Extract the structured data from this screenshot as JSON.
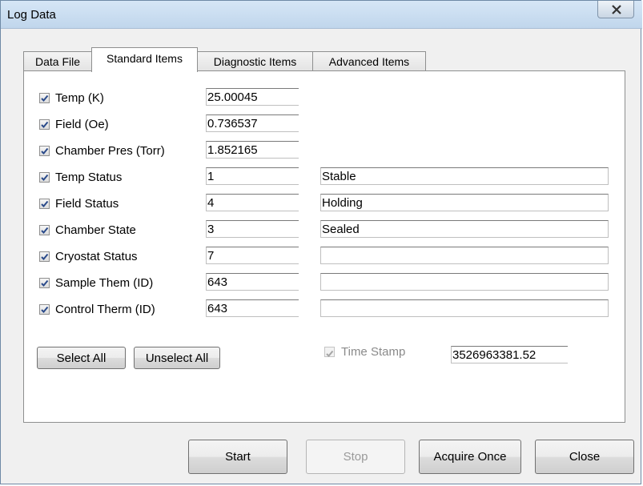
{
  "window": {
    "title": "Log Data"
  },
  "tabs": [
    {
      "label": "Data File",
      "active": false
    },
    {
      "label": "Standard Items",
      "active": true
    },
    {
      "label": "Diagnostic Items",
      "active": false
    },
    {
      "label": "Advanced Items",
      "active": false
    }
  ],
  "items": [
    {
      "label": "Temp (K)",
      "checked": true,
      "value": "25.00045",
      "status": null
    },
    {
      "label": "Field (Oe)",
      "checked": true,
      "value": "0.736537",
      "status": null
    },
    {
      "label": "Chamber Pres (Torr)",
      "checked": true,
      "value": "1.852165",
      "status": null
    },
    {
      "label": "Temp Status",
      "checked": true,
      "value": "1",
      "status": "Stable"
    },
    {
      "label": "Field Status",
      "checked": true,
      "value": "4",
      "status": "Holding"
    },
    {
      "label": "Chamber State",
      "checked": true,
      "value": "3",
      "status": "Sealed"
    },
    {
      "label": "Cryostat Status",
      "checked": true,
      "value": "7",
      "status": ""
    },
    {
      "label": "Sample Them (ID)",
      "checked": true,
      "value": "643",
      "status": ""
    },
    {
      "label": "Control Therm (ID)",
      "checked": true,
      "value": "643",
      "status": ""
    }
  ],
  "selection": {
    "select_all": "Select All",
    "unselect_all": "Unselect All"
  },
  "timestamp": {
    "label": "Time Stamp",
    "checked": true,
    "enabled": false,
    "value": "3526963381.52"
  },
  "footer": {
    "start": "Start",
    "stop": "Stop",
    "acquire_once": "Acquire Once",
    "close": "Close"
  }
}
